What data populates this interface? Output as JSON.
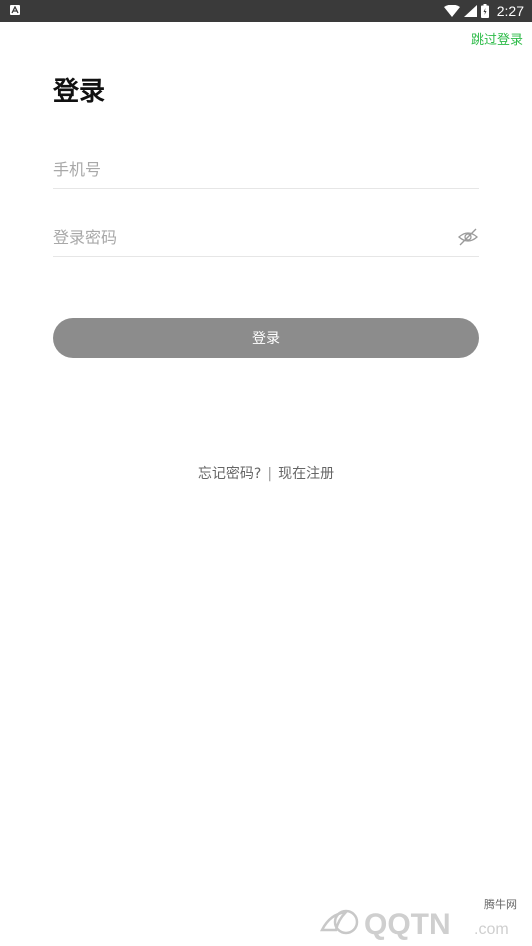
{
  "status_bar": {
    "time": "2:27",
    "left_icon": "notification-a-icon",
    "icons": [
      "wifi-icon",
      "signal-icon",
      "battery-icon"
    ]
  },
  "header": {
    "skip_login": "跳过登录"
  },
  "page": {
    "title": "登录"
  },
  "form": {
    "phone_placeholder": "手机号",
    "password_placeholder": "登录密码",
    "password_visibility_icon": "eye-hidden-icon",
    "login_button": "登录"
  },
  "links": {
    "forgot_password": "忘记密码?",
    "separator": "|",
    "register": "现在注册"
  },
  "watermark": {
    "text_top": "腾牛网",
    "text_main": "QQTN",
    "text_suffix": ".com"
  },
  "colors": {
    "status_bar": "#3a3a3a",
    "accent_green": "#2dbb48",
    "button_disabled": "#8c8c8c"
  }
}
